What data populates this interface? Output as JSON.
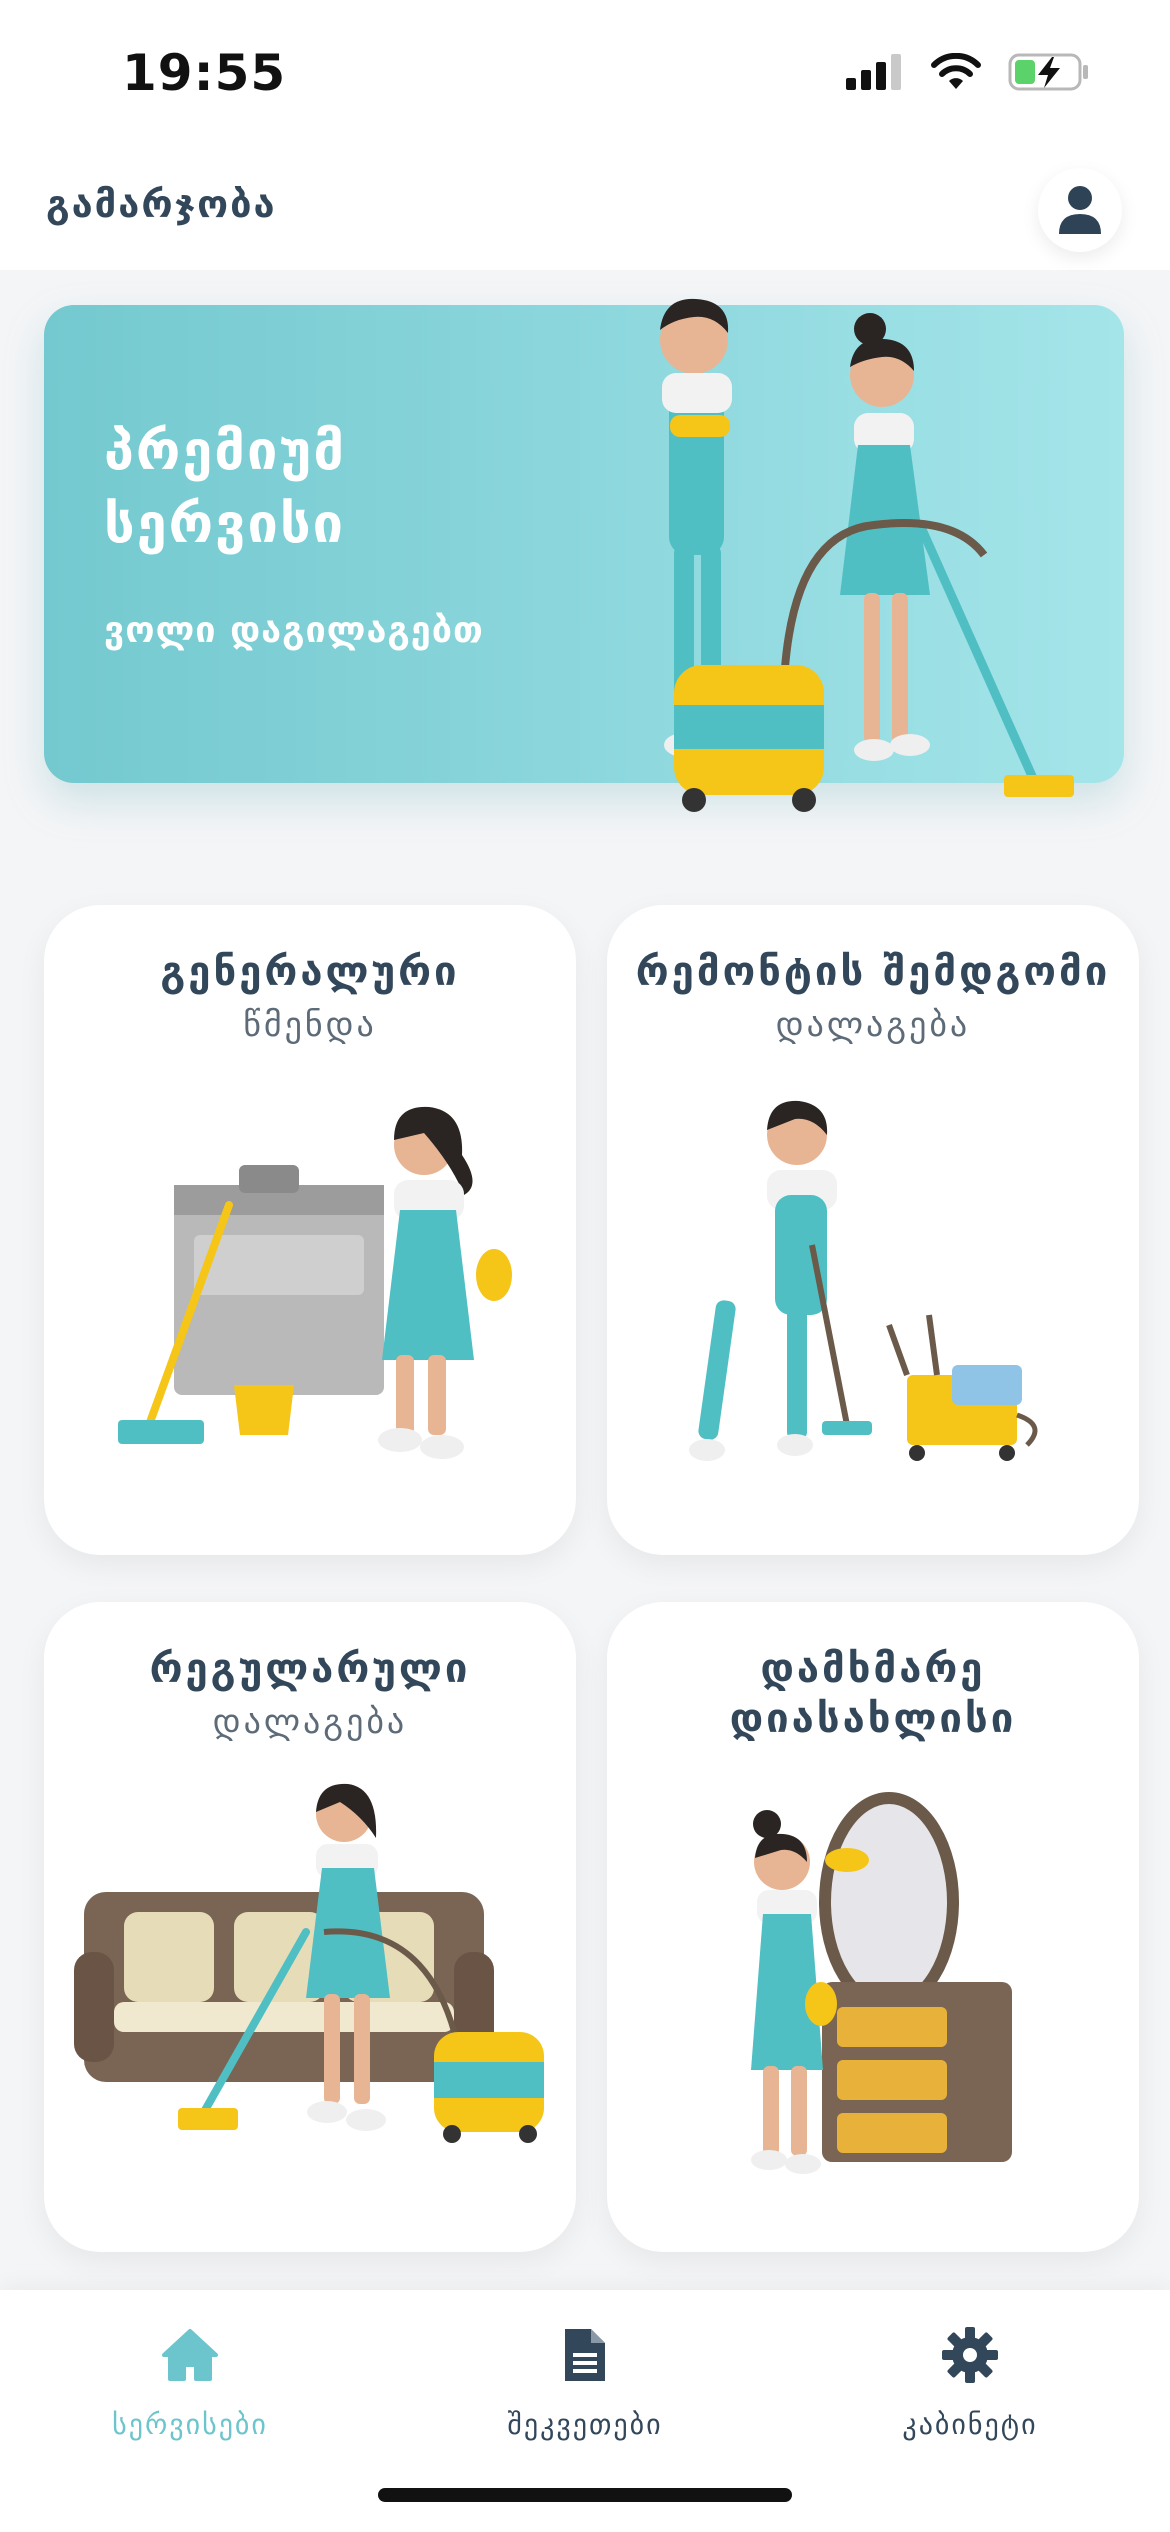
{
  "status_bar": {
    "time": "19:55"
  },
  "header": {
    "greeting": "გამარჯობა",
    "profile_icon": "user-icon"
  },
  "banner": {
    "title": "პრემიუმ სერვისი",
    "subtitle": "ვოლი დაგილაგებთ",
    "background": "#8ed8de"
  },
  "services": [
    {
      "title": "გენერალური",
      "subtitle": "წმენდა"
    },
    {
      "title": "რემონტის შემდგომი",
      "subtitle": "დალაგება"
    },
    {
      "title": "რეგულარული",
      "subtitle": "დალაგება"
    },
    {
      "title": "დამხმარე დიასახლისი",
      "subtitle": ""
    }
  ],
  "bottom_nav": {
    "items": [
      {
        "label": "სერვისები",
        "icon": "home-icon",
        "active": true
      },
      {
        "label": "შეკვეთები",
        "icon": "document-icon",
        "active": false
      },
      {
        "label": "კაბინეტი",
        "icon": "gear-icon",
        "active": false
      }
    ],
    "active_color": "#6cc5cd",
    "inactive_color": "#33475b"
  }
}
